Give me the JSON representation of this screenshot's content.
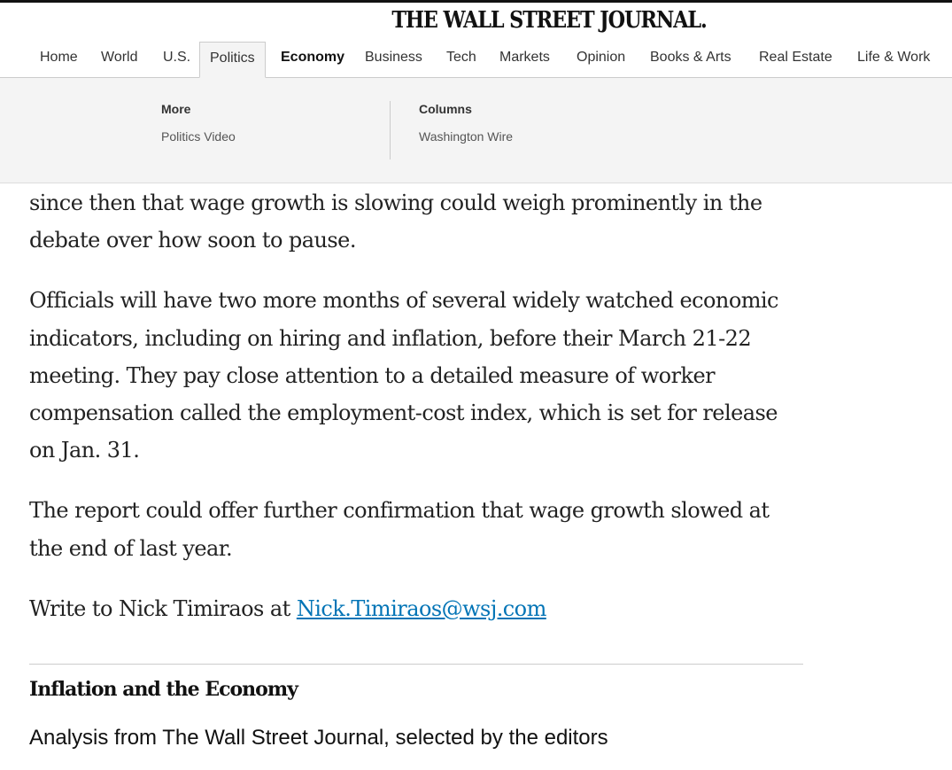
{
  "masthead": {
    "title": "THE WALL STREET JOURNAL."
  },
  "nav": {
    "items": [
      {
        "label": "Home"
      },
      {
        "label": "World"
      },
      {
        "label": "U.S."
      },
      {
        "label": "Politics",
        "active": true
      },
      {
        "label": "Economy",
        "bold": true
      },
      {
        "label": "Business"
      },
      {
        "label": "Tech"
      },
      {
        "label": "Markets"
      },
      {
        "label": "Opinion"
      },
      {
        "label": "Books & Arts"
      },
      {
        "label": "Real Estate"
      },
      {
        "label": "Life & Work"
      }
    ]
  },
  "subnav": {
    "more": {
      "heading": "More",
      "link": "Politics Video"
    },
    "columns": {
      "heading": "Columns",
      "link": "Washington Wire"
    }
  },
  "article": {
    "paragraphs": [
      "since then that wage growth is slowing could weigh prominently in the debate over how soon to pause.",
      "Officials will have two more months of several widely watched economic indicators, including on hiring and inflation, before their March 21-22 meeting. They pay close attention to a detailed measure of worker compensation called the employment-cost index, which is set for release on Jan. 31.",
      "The report could offer further confirmation that wage growth slowed at the end of last year."
    ],
    "write_to_prefix": "Write to Nick Timiraos at ",
    "author_email": "Nick.Timiraos@wsj.com"
  },
  "section": {
    "title": "Inflation and the Economy",
    "subtitle": "Analysis from The Wall Street Journal, selected by the editors"
  },
  "colors": {
    "link": "#0274b6",
    "subnav_background": "#f4f4f4",
    "text": "#222222"
  }
}
